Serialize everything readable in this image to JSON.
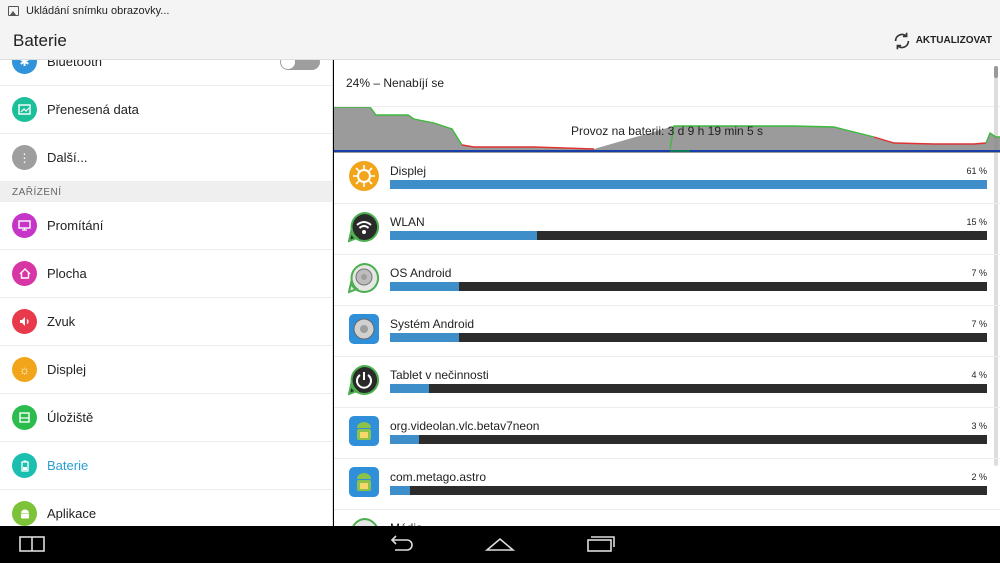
{
  "status_bar": {
    "notification": "Ukládání snímku obrazovky..."
  },
  "action_bar": {
    "title": "Baterie",
    "refresh_label": "AKTUALIZOVAT"
  },
  "sidebar": {
    "items_top": [
      {
        "label": "Bluetooth",
        "icon": "bluetooth-icon",
        "color": "#2f94d9"
      },
      {
        "label": "Přenesená data",
        "icon": "data-usage-icon",
        "color": "#1bbf9a"
      },
      {
        "label": "Další...",
        "icon": "more-icon",
        "color": "#9e9e9e"
      }
    ],
    "section": "ZAŘÍZENÍ",
    "items": [
      {
        "label": "Promítání",
        "icon": "cast-icon",
        "color": "#c535c8"
      },
      {
        "label": "Plocha",
        "icon": "home-icon",
        "color": "#d836a5"
      },
      {
        "label": "Zvuk",
        "icon": "sound-icon",
        "color": "#e83a4a"
      },
      {
        "label": "Displej",
        "icon": "display-icon",
        "color": "#f2a51a"
      },
      {
        "label": "Úložiště",
        "icon": "storage-icon",
        "color": "#2cbc4d"
      },
      {
        "label": "Baterie",
        "icon": "battery-icon",
        "color": "#1bbfb0",
        "active": true
      },
      {
        "label": "Aplikace",
        "icon": "apps-icon",
        "color": "#7cc33a"
      }
    ]
  },
  "battery": {
    "summary": "24% – Nenabíjí se",
    "level": 0.24,
    "graph_text": "Provoz na baterii: 3 d 9 h 19 min 5 s"
  },
  "apps": [
    {
      "name": "Displej",
      "percent_label": "61 %",
      "value": 61,
      "icon": "display-icon"
    },
    {
      "name": "WLAN",
      "percent_label": "15 %",
      "value": 15,
      "icon": "wifi-icon"
    },
    {
      "name": "OS Android",
      "percent_label": "7 %",
      "value": 7,
      "icon": "android-os-icon"
    },
    {
      "name": "Systém Android",
      "percent_label": "7 %",
      "value": 7,
      "icon": "android-system-icon"
    },
    {
      "name": "Tablet v nečinnosti",
      "percent_label": "4 %",
      "value": 4,
      "icon": "power-icon"
    },
    {
      "name": "org.videolan.vlc.betav7neon",
      "percent_label": "3 %",
      "value": 3,
      "icon": "android-app-icon"
    },
    {
      "name": "com.metago.astro",
      "percent_label": "2 %",
      "value": 2,
      "icon": "android-app-icon"
    },
    {
      "name": "Média",
      "percent_label": "",
      "value": 0,
      "icon": "media-icon"
    }
  ],
  "nav_bar": {
    "icons": [
      "split-screen-icon",
      "back-icon",
      "home-nav-icon",
      "recents-icon"
    ]
  },
  "colors": {
    "accent": "#2a9fd6",
    "bar_fill": "#3d8ec9",
    "bar_track": "#2c2c2c"
  }
}
